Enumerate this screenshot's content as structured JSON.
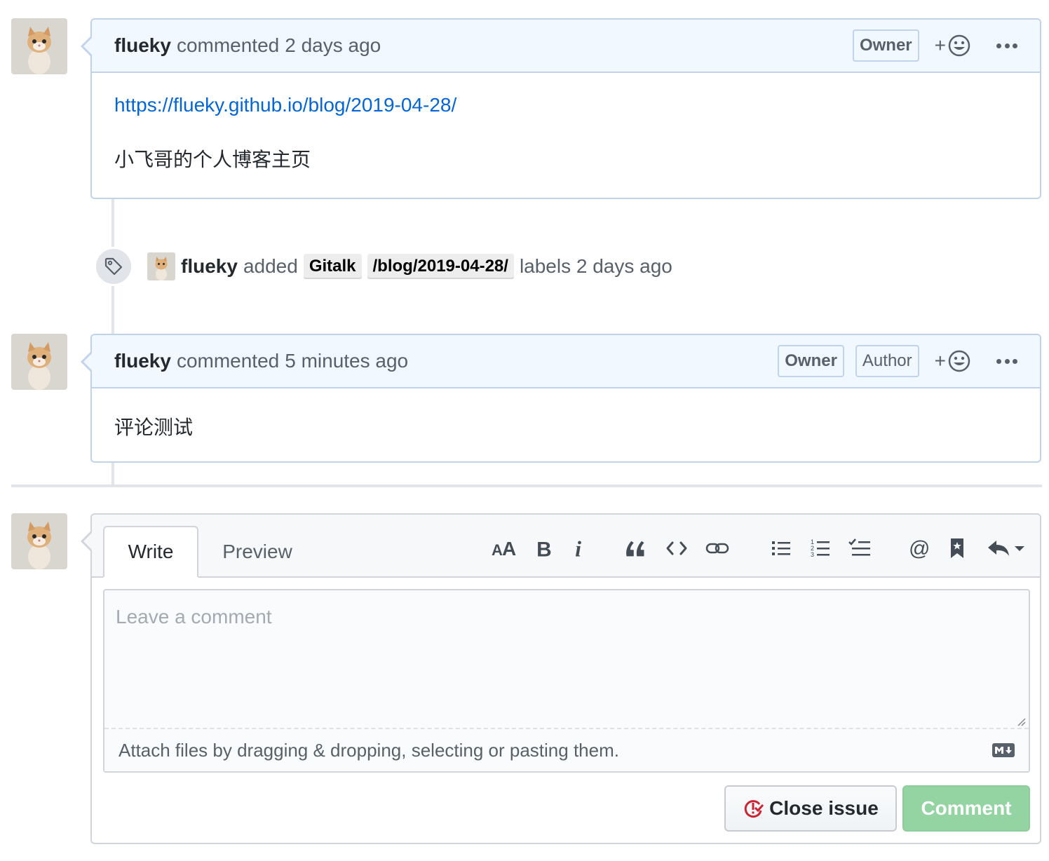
{
  "comments": [
    {
      "author": "flueky",
      "action": "commented",
      "time": "2 days ago",
      "roles": [
        "Owner"
      ],
      "link": "https://flueky.github.io/blog/2019-04-28/",
      "text": "小飞哥的个人博客主页"
    },
    {
      "author": "flueky",
      "action": "commented",
      "time": "5 minutes ago",
      "roles": [
        "Owner",
        "Author"
      ],
      "text": "评论测试"
    }
  ],
  "label_event": {
    "author": "flueky",
    "action": "added",
    "labels": [
      "Gitalk",
      "/blog/2019-04-28/"
    ],
    "suffix": "labels 2 days ago"
  },
  "react_plus": "+",
  "editor": {
    "tabs": [
      "Write",
      "Preview"
    ],
    "active_tab": "Write",
    "toolbar": [
      "header-icon",
      "bold-icon",
      "italic-icon",
      "quote-icon",
      "code-icon",
      "link-icon",
      "bulleted-list-icon",
      "numbered-list-icon",
      "task-list-icon",
      "mention-icon",
      "saved-reply-icon",
      "reply-icon"
    ],
    "placeholder": "Leave a comment",
    "attach_hint": "Attach files by dragging & dropping, selecting or pasting them.",
    "buttons": {
      "close": "Close issue",
      "comment": "Comment"
    }
  },
  "colors": {
    "link": "#0366d6",
    "header_bg": "#f1f8ff",
    "border_blue": "#c0d3eb",
    "comment_button": "#94d3a2",
    "close_icon": "#cb2431"
  }
}
